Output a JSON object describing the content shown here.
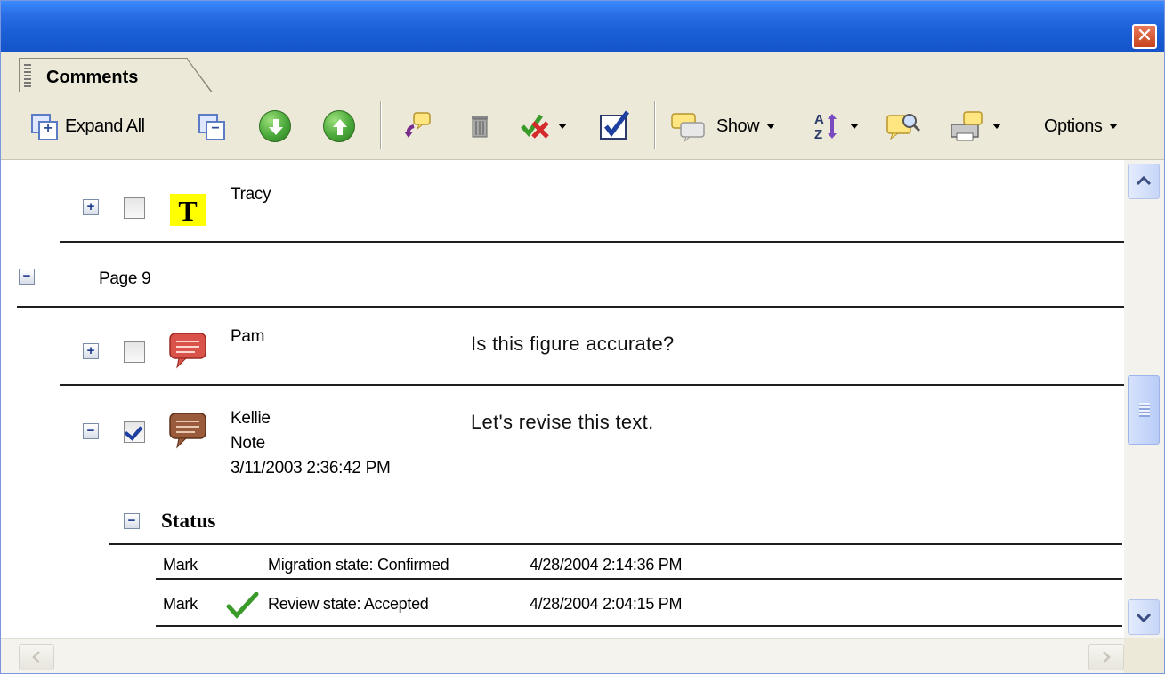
{
  "window": {
    "close_glyph": "✕"
  },
  "tab": {
    "label": "Comments"
  },
  "toolbar": {
    "expand_all": "Expand All",
    "show": "Show",
    "options": "Options"
  },
  "comments": {
    "tracy": {
      "author": "Tracy",
      "expander": "+"
    },
    "page": {
      "label": "Page 9",
      "expander": "−"
    },
    "pam": {
      "author": "Pam",
      "text": "Is this figure accurate?",
      "expander": "+"
    },
    "kellie": {
      "author": "Kellie",
      "type": "Note",
      "date": "3/11/2003 2:36:42 PM",
      "text": "Let's revise this text.",
      "expander": "−"
    }
  },
  "status": {
    "heading": "Status",
    "expander": "−",
    "rows": [
      {
        "user": "Mark",
        "state": "Migration state: Confirmed",
        "date": "4/28/2004 2:14:36 PM"
      },
      {
        "user": "Mark",
        "state": "Review state: Accepted",
        "date": "4/28/2004 2:04:15 PM"
      }
    ]
  },
  "colors": {
    "titlebar": "#1a5fd6",
    "chrome": "#ece9d8",
    "highlight_yellow": "#ffff00",
    "note_red": "#d9534a",
    "note_brown": "#9a5a3c",
    "check_green": "#3a9a2a",
    "check_blue": "#1d3fa0"
  },
  "icons": {
    "expand_all": "expand-all-icon",
    "collapse_all": "collapse-all-icon",
    "next": "next-comment-icon",
    "previous": "previous-comment-icon",
    "reply": "reply-icon",
    "delete": "trash-icon",
    "set_status": "set-status-icon",
    "checkmark": "checkmark-icon",
    "show": "show-comments-icon",
    "sort": "sort-icon",
    "search": "search-comments-icon",
    "print": "print-comments-icon"
  }
}
